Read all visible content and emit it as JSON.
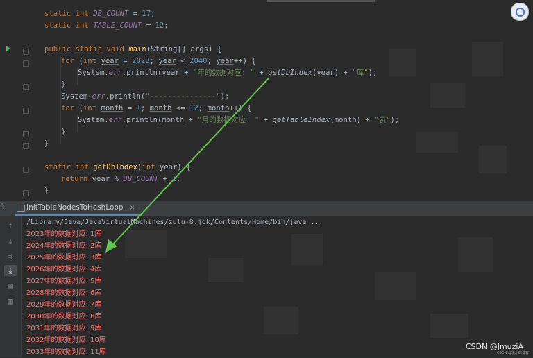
{
  "editor": {
    "code": [
      "static int DB_COUNT = 17;",
      "static int TABLE_COUNT = 12;",
      "public static void main(String[] args) {",
      "for (int year = 2023; year < 2040; year++) {",
      "System.err.println(year + \"年的数据对应: \" + getDbIndex(year) + \"库\");",
      "}",
      "System.err.println(\"---------------\");",
      "for (int month = 1; month <= 12; month++) {",
      "System.err.println(month + \"月的数据对应: \" + getTableIndex(month) + \"表\");",
      "}",
      "}",
      "static int getDbIndex(int year) {",
      "return year % DB_COUNT + 1;",
      "}"
    ],
    "tokens": {
      "static": "static",
      "int": "int",
      "db_count": "DB_COUNT",
      "table_count": "TABLE_COUNT",
      "n17": "17",
      "n12": "12",
      "public": "public",
      "void": "void",
      "main": "main",
      "string_args": "(String[] args) {",
      "for": "for",
      "year": "year",
      "n2023": "2023",
      "n2040": "2040",
      "system_err": "System.",
      "err": "err",
      "println": ".println(",
      "str_year": "\"年的数据对应: \"",
      "get_db_index": "getDbIndex",
      "str_ku": "\"库\"",
      "str_dash": "\"---------------\"",
      "month": "month",
      "n1": "1",
      "str_month": "\"月的数据对应: \"",
      "get_table_index": "getTableIndex",
      "str_biao": "\"表\"",
      "return": "return"
    }
  },
  "tool_window": {
    "prefix": "f:",
    "tab_label": "InitTableNodesToHashLoop",
    "tab_close": "✕"
  },
  "console": {
    "command": "/Library/Java/JavaVirtualMachines/zulu-8.jdk/Contents/Home/bin/java ...",
    "output": [
      "2023年的数据对应: 1库",
      "2024年的数据对应: 2库",
      "2025年的数据对应: 3库",
      "2026年的数据对应: 4库",
      "2027年的数据对应: 5库",
      "2028年的数据对应: 6库",
      "2029年的数据对应: 7库",
      "2030年的数据对应: 8库",
      "2031年的数据对应: 9库",
      "2032年的数据对应: 10库",
      "2033年的数据对应: 11库"
    ],
    "toolbar_icons": [
      "arrow-up-icon",
      "arrow-down-icon",
      "soft-wrap-icon",
      "scroll-to-end-icon",
      "print-icon",
      "trash-icon"
    ]
  },
  "watermark": {
    "text": "CSDN @JmuziA",
    "small": "CSDN @快乐的博客"
  },
  "colors": {
    "editor_bg": "#2b2b2b",
    "keyword": "#cc7832",
    "constant": "#9876aa",
    "number": "#6897bb",
    "string": "#6a8759",
    "method": "#ffc66d",
    "console_output": "#ff6b68",
    "arrow": "#62c64c"
  }
}
